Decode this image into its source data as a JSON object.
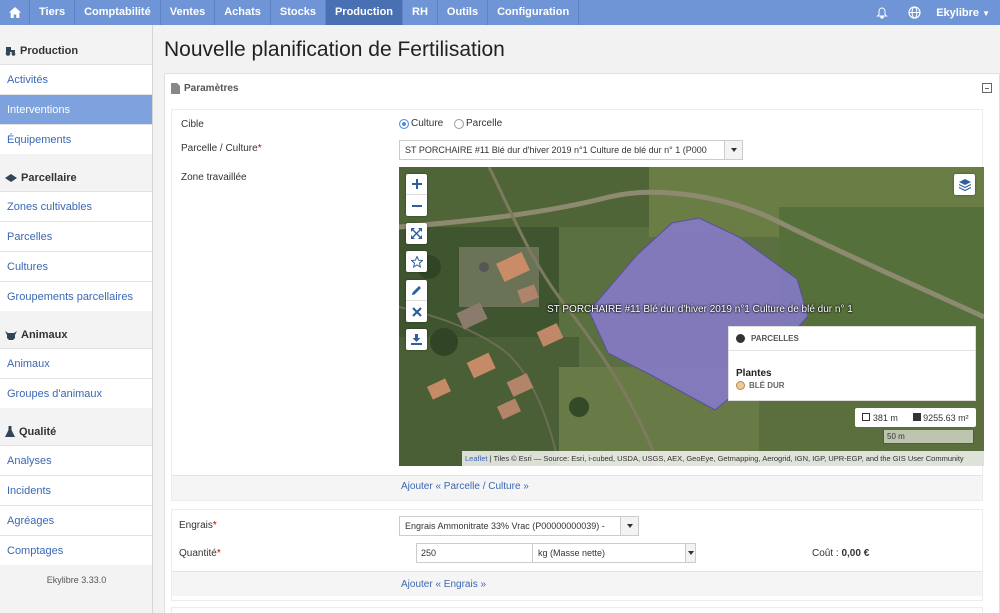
{
  "nav": {
    "items": [
      "Tiers",
      "Comptabilité",
      "Ventes",
      "Achats",
      "Stocks",
      "Production",
      "RH",
      "Outils",
      "Configuration"
    ],
    "active": "Production",
    "user": "Ekylibre"
  },
  "sidebar": {
    "sections": [
      {
        "title": "Production",
        "icon": "tractor-icon",
        "items": [
          "Activités",
          "Interventions",
          "Équipements"
        ]
      },
      {
        "title": "Parcellaire",
        "icon": "field-icon",
        "items": [
          "Zones cultivables",
          "Parcelles",
          "Cultures",
          "Groupements parcellaires"
        ]
      },
      {
        "title": "Animaux",
        "icon": "cow-icon",
        "items": [
          "Animaux",
          "Groupes d'animaux"
        ]
      },
      {
        "title": "Qualité",
        "icon": "flask-icon",
        "items": [
          "Analyses",
          "Incidents",
          "Agréages",
          "Comptages"
        ]
      }
    ],
    "active_item": "Interventions",
    "version": "Ekylibre 3.33.0"
  },
  "page": {
    "title": "Nouvelle planification de Fertilisation"
  },
  "panel": {
    "heading": "Paramètres",
    "cible_label": "Cible",
    "cible_options": [
      "Culture",
      "Parcelle"
    ],
    "cible_selected": "Culture",
    "parcelle_label": "Parcelle / Culture",
    "parcelle_value": "ST PORCHAIRE #11 Blé dur d'hiver 2019 n°1 Culture de blé dur n° 1 (P000",
    "zone_label": "Zone travaillée",
    "add_parcelle": "Ajouter « Parcelle / Culture »",
    "engrais_label": "Engrais",
    "engrais_value": "Engrais Ammonitrate 33% Vrac (P00000000039) -",
    "quantite_label": "Quantité",
    "quantite_value": "250",
    "unit_value": "kg (Masse nette)",
    "cout_label": "Coût :",
    "cout_value": "0,00 €",
    "add_engrais": "Ajouter « Engrais »"
  },
  "map": {
    "polygon_label": "ST PORCHAIRE #11 Blé dur d'hiver 2019 n°1 Culture de blé dur n° 1",
    "legend_parcelles": "PARCELLES",
    "legend_plantes": "Plantes",
    "legend_ble": "BLÉ DUR",
    "perimeter": "381 m",
    "area": "9255.63 m²",
    "scale": "50 m",
    "leaflet": "Leaflet",
    "attribution": " | Tiles © Esri — Source: Esri, i-cubed, USDA, USGS, AEX, GeoEye, Getmapping, Aerogrid, IGN, IGP, UPR-EGP, and the GIS User Community",
    "polygon_color": "#8479c4",
    "ble_color": "#f0c892",
    "parcelles_color": "#333333"
  },
  "colors": {
    "nav": "#6f95d6",
    "nav_active": "#4a70b4",
    "sidebar_active": "#7ea2de",
    "link": "#3a68b5"
  }
}
